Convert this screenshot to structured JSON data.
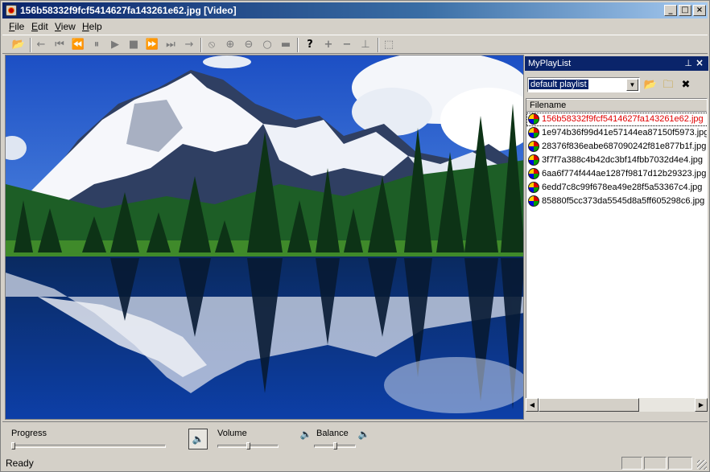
{
  "window": {
    "title": "156b58332f9fcf5414627fa143261e62.jpg [Video]",
    "controls": {
      "minimize": "_",
      "maximize": "□",
      "close": "×"
    }
  },
  "menu": [
    {
      "label": "File",
      "underline": "F",
      "rest": "ile"
    },
    {
      "label": "Edit",
      "underline": "E",
      "rest": "dit"
    },
    {
      "label": "View",
      "underline": "V",
      "rest": "iew"
    },
    {
      "label": "Help",
      "underline": "H",
      "rest": "elp"
    }
  ],
  "toolbar": {
    "icons": {
      "open": "📂",
      "back": "←",
      "first": "⏮",
      "rewind": "⏪",
      "pause": "⏸",
      "play": "▶",
      "stop": "■",
      "fast_forward": "⏩",
      "last": "⏭",
      "forward": "→",
      "zoom_fit": "⦸",
      "zoom_in": "⊕",
      "zoom_out": "⊖",
      "zoom_actual": "○",
      "fullscreen": "▬",
      "help": "?",
      "add": "+",
      "remove": "−",
      "info": "⊥",
      "select": "⬚"
    }
  },
  "playlist": {
    "title": "MyPlayList",
    "pin": "⊥",
    "close": "×",
    "selected_playlist": "default playlist",
    "tool_icons": {
      "open_folder": "📂",
      "add_files": "🗀",
      "clear": "✖"
    },
    "column_header": "Filename",
    "items": [
      {
        "name": "156b58332f9fcf5414627fa143261e62.jpg",
        "current": true
      },
      {
        "name": "1e974b36f99d41e57144ea87150f5973.jpg",
        "current": false
      },
      {
        "name": "28376f836eabe687090242f81e877b1f.jpg",
        "current": false
      },
      {
        "name": "3f7f7a388c4b42dc3bf14fbb7032d4e4.jpg",
        "current": false
      },
      {
        "name": "6aa6f774f444ae1287f9817d12b29323.jpg",
        "current": false
      },
      {
        "name": "6edd7c8c99f678ea49e28f5a53367c4.jpg",
        "current": false
      },
      {
        "name": "85880f5cc373da5545d8a5ff605298c6.jpg",
        "current": false
      }
    ]
  },
  "controls": {
    "progress_label": "Progress",
    "progress_value": 0,
    "volume_label": "Volume",
    "volume_value": 0.5,
    "balance_label": "Balance",
    "balance_value": 0.5,
    "speaker_icon": "🔈"
  },
  "status": {
    "text": "Ready"
  },
  "colors": {
    "current_item": "#e00000",
    "titlebar": "#0a246a"
  }
}
